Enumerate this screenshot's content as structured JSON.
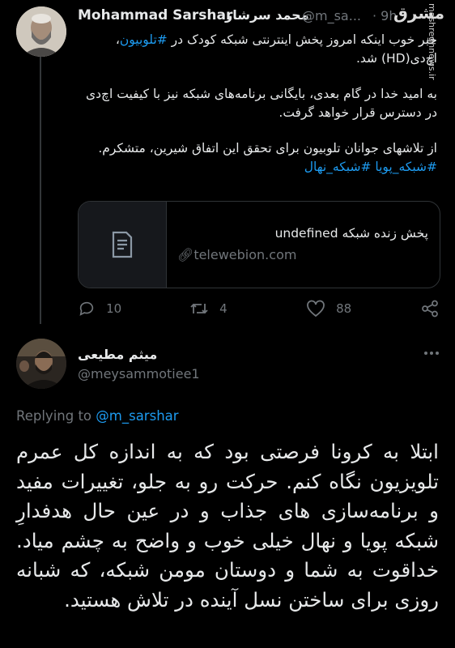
{
  "tweet1": {
    "display_name_en": "Mohammad Sarshar",
    "display_name_fa": "محمد سرشار",
    "handle": "@m_sa...",
    "time": "· 9h",
    "text_p1_a": "خبر خوب اینکه امروز پخش اینترنتی شبکه کودک در ",
    "text_p1_link": "#تلوبیون",
    "text_p1_b": "، اچ‌دی(HD) شد.",
    "text_p2": "به امید خدا در گام بعدی، بایگانی برنامه‌های شبکه نیز با کیفیت اچ‌دی در دسترس قرار خواهد گرفت.",
    "text_p3": "از تلاشهای جوانان تلوبیون برای تحقق این اتفاق شیرین، متشکرم.",
    "hashtags": "#شبکه_پویا #شبکه_نهال",
    "card": {
      "title": "پخش زنده شبکه undefined",
      "domain": "telewebion.com"
    },
    "reply_count": "10",
    "retweet_count": "4",
    "like_count": "88"
  },
  "tweet2": {
    "display_name": "میثم مطیعی",
    "handle": "@meysammotiee1",
    "replying_label": "Replying to",
    "replying_handle": "@m_sarshar",
    "text": "ابتلا به کرونا فرصتی بود که به اندازه کل عمرم تلویزیون نگاه کنم. حرکت رو به جلو، تغییرات مفید و برنامه‌سازی های جذاب و در عین حال هدفدارِ شبکه پویا و نهال خیلی خوب و واضح به چشم میاد. خداقوت به شما و دوستان مومن شبکه، که شبانه روزی برای ساختن نسل آینده در تلاش هستید."
  },
  "watermark": {
    "logo_text": "مشرق",
    "site": "mashreghnews.ir"
  },
  "colors": {
    "accent": "#1d9bf0",
    "muted": "#71767b",
    "border": "#2f3336",
    "background": "#000000"
  }
}
